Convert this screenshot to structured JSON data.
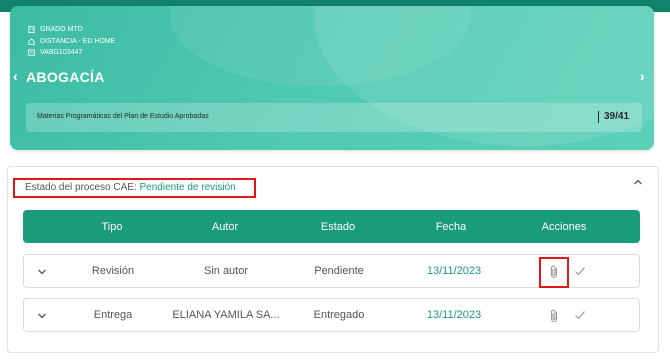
{
  "header": {
    "grado": "GRADO MTD",
    "modalidad": "DISTANCIA - ED HOME",
    "codigo": "VABG103447",
    "career": "ABOGACÍA",
    "progress_label": "Materias Programáticas del Plan de Estudio Aprobadas",
    "progress_count": "39/41",
    "progress_fraction": 0.951
  },
  "process": {
    "label": "Estado del proceso CAE:",
    "value": "Pendiente de revisión"
  },
  "table": {
    "columns": [
      "Tipo",
      "Autor",
      "Estado",
      "Fecha",
      "Acciones"
    ],
    "rows": [
      {
        "tipo": "Revisión",
        "autor": "Sin autor",
        "estado": "Pendiente",
        "fecha": "13/11/2023"
      },
      {
        "tipo": "Entrega",
        "autor": "ELIANA YAMILA SA...",
        "estado": "Entregado",
        "fecha": "13/11/2023"
      }
    ]
  },
  "icons": {
    "nav_prev": "‹",
    "nav_next": "›",
    "collapse": "^"
  },
  "colors": {
    "accent": "#1a9b7b",
    "hero": "#4fc9b0",
    "highlight": "#e01818",
    "topbar": "#12836b"
  }
}
